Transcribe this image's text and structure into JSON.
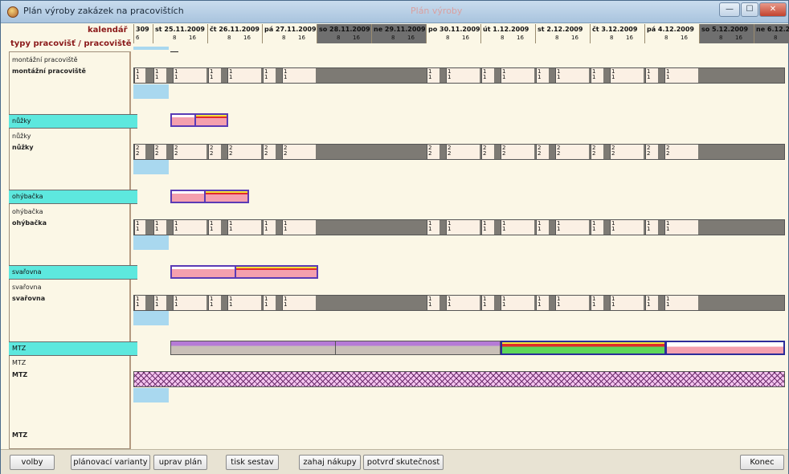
{
  "window": {
    "title": "Plán výroby zakázek na pracovištích",
    "ghost_text": "Plán výroby",
    "min_label": "—",
    "max_label": "☐",
    "close_label": "✕"
  },
  "header": {
    "calendar_label": "kalendář",
    "types_label": "typy pracovišť / pracoviště"
  },
  "calendar": {
    "days": [
      {
        "label": "309",
        "weekend": false,
        "hours": [
          "6"
        ]
      },
      {
        "label": "st 25.11.2009",
        "weekend": false,
        "hours": [
          "8",
          "16"
        ]
      },
      {
        "label": "čt 26.11.2009",
        "weekend": false,
        "hours": [
          "8",
          "16"
        ]
      },
      {
        "label": "pá 27.11.2009",
        "weekend": false,
        "hours": [
          "8",
          "16"
        ]
      },
      {
        "label": "so 28.11.2009",
        "weekend": true,
        "hours": [
          "8",
          "16"
        ]
      },
      {
        "label": "ne 29.11.2009",
        "weekend": true,
        "hours": [
          "8",
          "16"
        ]
      },
      {
        "label": "po 30.11.2009",
        "weekend": false,
        "hours": [
          "8",
          "16"
        ]
      },
      {
        "label": "út 1.12.2009",
        "weekend": false,
        "hours": [
          "8",
          "16"
        ]
      },
      {
        "label": "st 2.12.2009",
        "weekend": false,
        "hours": [
          "8",
          "16"
        ]
      },
      {
        "label": "čt 3.12.2009",
        "weekend": false,
        "hours": [
          "8",
          "16"
        ]
      },
      {
        "label": "pá 4.12.2009",
        "weekend": false,
        "hours": [
          "8",
          "16"
        ]
      },
      {
        "label": "so 5.12.2009",
        "weekend": true,
        "hours": [
          "8",
          "16"
        ]
      },
      {
        "label": "ne 6.12.2",
        "weekend": true,
        "hours": [
          "8",
          "16"
        ]
      }
    ]
  },
  "sections": [
    {
      "type_label": "montážní pracoviště",
      "workplace_label": "montážní pracoviště",
      "capacity": "1"
    },
    {
      "type_label": "nůžky",
      "sub_label": "nůžky",
      "workplace_label": "nůžky",
      "capacity": "2"
    },
    {
      "type_label": "ohýbačka",
      "sub_label": "ohýbačka",
      "workplace_label": "ohýbačka",
      "capacity": "1"
    },
    {
      "type_label": "svařovna",
      "sub_label": "svařovna",
      "workplace_label": "svařovna",
      "capacity": "1"
    },
    {
      "type_label": "MTZ",
      "sub_label": "MTZ",
      "workplace_label": "MTZ",
      "extra_label": "MTZ"
    }
  ],
  "toolbar": {
    "volby": "volby",
    "planovaci_varianty": "plánovací varianty",
    "uprav_plan": "uprav plán",
    "tisk_sestav": "tisk sestav",
    "zahaj_nakupy": "zahaj nákupy",
    "potvrd_skutecnost": "potvrď skutečnost",
    "konec": "Konec"
  },
  "colors": {
    "type_header": "#5de8de",
    "task_pink": "#f4a0ae",
    "task_border": "#5a3bb5",
    "weekend": "#6f6f6f",
    "today_marker": "#a9d8ef"
  }
}
